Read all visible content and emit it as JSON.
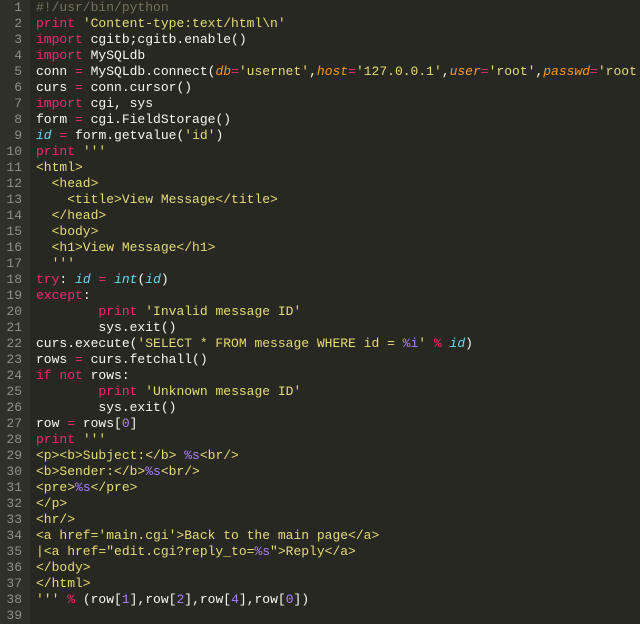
{
  "editor": {
    "start_line": 1,
    "lines": [
      [
        [
          "c-comment",
          "#!/usr/bin/python"
        ]
      ],
      [
        [
          "c-keyword",
          "print"
        ],
        [
          "c-default",
          " "
        ],
        [
          "c-string",
          "'Content-type:text/html\\n'"
        ]
      ],
      [
        [
          "c-keyword",
          "import"
        ],
        [
          "c-default",
          " cgitb;cgitb.enable()"
        ]
      ],
      [
        [
          "c-keyword",
          "import"
        ],
        [
          "c-default",
          " MySQLdb"
        ]
      ],
      [
        [
          "c-default",
          "conn "
        ],
        [
          "c-keyword",
          "="
        ],
        [
          "c-default",
          " MySQLdb.connect("
        ],
        [
          "c-param",
          "db"
        ],
        [
          "c-keyword",
          "="
        ],
        [
          "c-string",
          "'usernet'"
        ],
        [
          "c-default",
          ","
        ],
        [
          "c-param",
          "host"
        ],
        [
          "c-keyword",
          "="
        ],
        [
          "c-string",
          "'127.0.0.1'"
        ],
        [
          "c-default",
          ","
        ],
        [
          "c-param",
          "user"
        ],
        [
          "c-keyword",
          "="
        ],
        [
          "c-string",
          "'root'"
        ],
        [
          "c-default",
          ","
        ],
        [
          "c-param",
          "passwd"
        ],
        [
          "c-keyword",
          "="
        ],
        [
          "c-string",
          "'root'"
        ],
        [
          "c-default",
          ")"
        ]
      ],
      [
        [
          "c-default",
          "curs "
        ],
        [
          "c-keyword",
          "="
        ],
        [
          "c-default",
          " conn.cursor()"
        ]
      ],
      [
        [
          "c-keyword",
          "import"
        ],
        [
          "c-default",
          " cgi, sys"
        ]
      ],
      [
        [
          "c-default",
          "form "
        ],
        [
          "c-keyword",
          "="
        ],
        [
          "c-default",
          " cgi.FieldStorage()"
        ]
      ],
      [
        [
          "c-builtin",
          "id"
        ],
        [
          "c-default",
          " "
        ],
        [
          "c-keyword",
          "="
        ],
        [
          "c-default",
          " form.getvalue("
        ],
        [
          "c-string",
          "'id'"
        ],
        [
          "c-default",
          ")"
        ]
      ],
      [
        [
          "c-keyword",
          "print"
        ],
        [
          "c-default",
          " "
        ],
        [
          "c-string",
          "'''"
        ]
      ],
      [
        [
          "c-string",
          "<html>"
        ]
      ],
      [
        [
          "c-string",
          "  <head>"
        ]
      ],
      [
        [
          "c-string",
          "    <title>View Message</title>"
        ]
      ],
      [
        [
          "c-string",
          "  </head>"
        ]
      ],
      [
        [
          "c-string",
          "  <body>"
        ]
      ],
      [
        [
          "c-string",
          "  <h1>View Message</h1>"
        ]
      ],
      [
        [
          "c-string",
          "  '''"
        ]
      ],
      [
        [
          "c-keyword",
          "try"
        ],
        [
          "c-default",
          ": "
        ],
        [
          "c-builtin",
          "id"
        ],
        [
          "c-default",
          " "
        ],
        [
          "c-keyword",
          "="
        ],
        [
          "c-default",
          " "
        ],
        [
          "c-builtin",
          "int"
        ],
        [
          "c-default",
          "("
        ],
        [
          "c-builtin",
          "id"
        ],
        [
          "c-default",
          ")"
        ]
      ],
      [
        [
          "c-keyword",
          "except"
        ],
        [
          "c-default",
          ":"
        ]
      ],
      [
        [
          "c-default",
          "        "
        ],
        [
          "c-keyword",
          "print"
        ],
        [
          "c-default",
          " "
        ],
        [
          "c-string",
          "'Invalid message ID'"
        ]
      ],
      [
        [
          "c-default",
          "        sys.exit()"
        ]
      ],
      [
        [
          "c-default",
          "curs.execute("
        ],
        [
          "c-string",
          "'SELECT * FROM message WHERE id = "
        ],
        [
          "c-number",
          "%i"
        ],
        [
          "c-string",
          "'"
        ],
        [
          "c-default",
          " "
        ],
        [
          "c-keyword",
          "%"
        ],
        [
          "c-default",
          " "
        ],
        [
          "c-builtin",
          "id"
        ],
        [
          "c-default",
          ")"
        ]
      ],
      [
        [
          "c-default",
          "rows "
        ],
        [
          "c-keyword",
          "="
        ],
        [
          "c-default",
          " curs.fetchall()"
        ]
      ],
      [
        [
          "c-keyword",
          "if"
        ],
        [
          "c-default",
          " "
        ],
        [
          "c-keyword",
          "not"
        ],
        [
          "c-default",
          " rows:"
        ]
      ],
      [
        [
          "c-default",
          "        "
        ],
        [
          "c-keyword",
          "print"
        ],
        [
          "c-default",
          " "
        ],
        [
          "c-string",
          "'Unknown message ID'"
        ]
      ],
      [
        [
          "c-default",
          "        sys.exit()"
        ]
      ],
      [
        [
          "c-default",
          "row "
        ],
        [
          "c-keyword",
          "="
        ],
        [
          "c-default",
          " rows["
        ],
        [
          "c-number",
          "0"
        ],
        [
          "c-default",
          "]"
        ]
      ],
      [
        [
          "c-keyword",
          "print"
        ],
        [
          "c-default",
          " "
        ],
        [
          "c-string",
          "'''"
        ]
      ],
      [
        [
          "c-string",
          "<p><b>Subject:</b> "
        ],
        [
          "c-number",
          "%s"
        ],
        [
          "c-string",
          "<br/>"
        ]
      ],
      [
        [
          "c-string",
          "<b>Sender:</b>"
        ],
        [
          "c-number",
          "%s"
        ],
        [
          "c-string",
          "<br/>"
        ]
      ],
      [
        [
          "c-string",
          "<pre>"
        ],
        [
          "c-number",
          "%s"
        ],
        [
          "c-string",
          "</pre>"
        ]
      ],
      [
        [
          "c-string",
          "</p>"
        ]
      ],
      [
        [
          "c-string",
          "<hr/>"
        ]
      ],
      [
        [
          "c-string",
          "<a href='main.cgi'>Back to the main page</a>"
        ]
      ],
      [
        [
          "c-string",
          "|<a href=\"edit.cgi?reply_to="
        ],
        [
          "c-number",
          "%s"
        ],
        [
          "c-string",
          "\">Reply</a>"
        ]
      ],
      [
        [
          "c-string",
          "</body>"
        ]
      ],
      [
        [
          "c-string",
          "</html>"
        ]
      ],
      [
        [
          "c-string",
          "'''"
        ],
        [
          "c-default",
          " "
        ],
        [
          "c-keyword",
          "%"
        ],
        [
          "c-default",
          " (row["
        ],
        [
          "c-number",
          "1"
        ],
        [
          "c-default",
          "],row["
        ],
        [
          "c-number",
          "2"
        ],
        [
          "c-default",
          "],row["
        ],
        [
          "c-number",
          "4"
        ],
        [
          "c-default",
          "],row["
        ],
        [
          "c-number",
          "0"
        ],
        [
          "c-default",
          "])"
        ]
      ],
      []
    ]
  }
}
